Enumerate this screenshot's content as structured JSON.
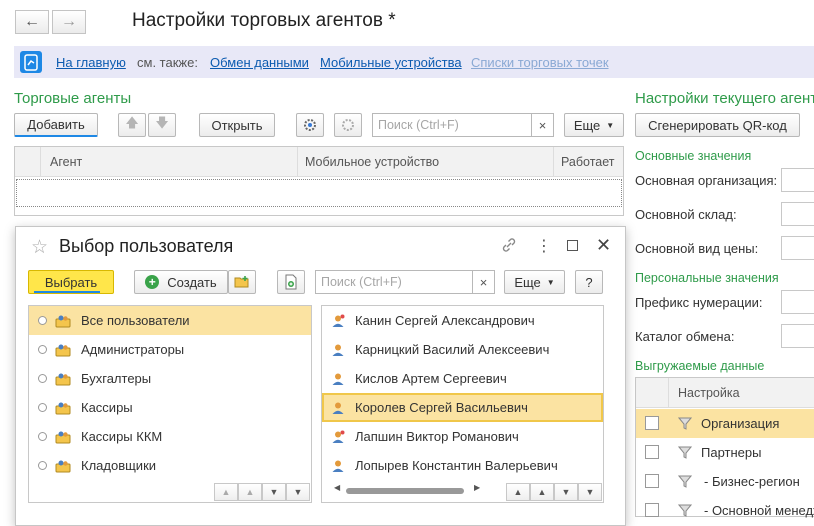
{
  "window": {
    "title": "Настройки торговых агентов *"
  },
  "nav": {
    "home": "На главную",
    "see_also": "см. также:",
    "links": [
      "Обмен данными",
      "Мобильные устройства"
    ],
    "disabled_link": "Списки торговых точек"
  },
  "agents": {
    "title": "Торговые агенты",
    "add_label": "Добавить",
    "open_label": "Открыть",
    "search_placeholder": "Поиск (Ctrl+F)",
    "clear_symbol": "×",
    "more_label": "Еще",
    "columns": [
      "Агент",
      "Мобильное устройство",
      "Работает"
    ]
  },
  "current_agent": {
    "title": "Настройки текущего агента",
    "qr_label": "Сгенерировать QR-код",
    "main_values_title": "Основные значения",
    "main_fields": [
      "Основная организация:",
      "Основной склад:",
      "Основной вид цены:"
    ],
    "personal_title": "Персональные значения",
    "personal_fields": [
      "Префикс нумерации:",
      "Каталог обмена:"
    ],
    "export_title": "Выгружаемые данные",
    "export_column": "Настройка",
    "export_rows": [
      "Организация",
      "Партнеры",
      "- Бизнес-регион",
      "- Основной менеджер"
    ]
  },
  "dialog": {
    "title": "Выбор пользователя",
    "select_label": "Выбрать",
    "create_label": "Создать",
    "search_placeholder": "Поиск (Ctrl+F)",
    "clear_symbol": "×",
    "more_label": "Еще",
    "help_label": "?",
    "groups": [
      "Все пользователи",
      "Администраторы",
      "Бухгалтеры",
      "Кассиры",
      "Кассиры ККМ",
      "Кладовщики"
    ],
    "selected_group": 0,
    "users": [
      {
        "name": "Канин Сергей Александрович",
        "marked": true
      },
      {
        "name": "Карницкий Василий Алексеевич",
        "marked": false
      },
      {
        "name": "Кислов Артем Сергеевич",
        "marked": false
      },
      {
        "name": "Королев Сергей Васильевич",
        "marked": false
      },
      {
        "name": "Лапшин Виктор Романович",
        "marked": true
      },
      {
        "name": "Лопырев Константин Валерьевич",
        "marked": false
      }
    ],
    "selected_user": 3
  },
  "colors": {
    "accent_green": "#2f9b4a",
    "link_blue": "#0c5bb0",
    "select_yellow": "#ffe64a",
    "row_highlight": "#fbe3a2",
    "nav_bar": "#e8e8f7"
  }
}
